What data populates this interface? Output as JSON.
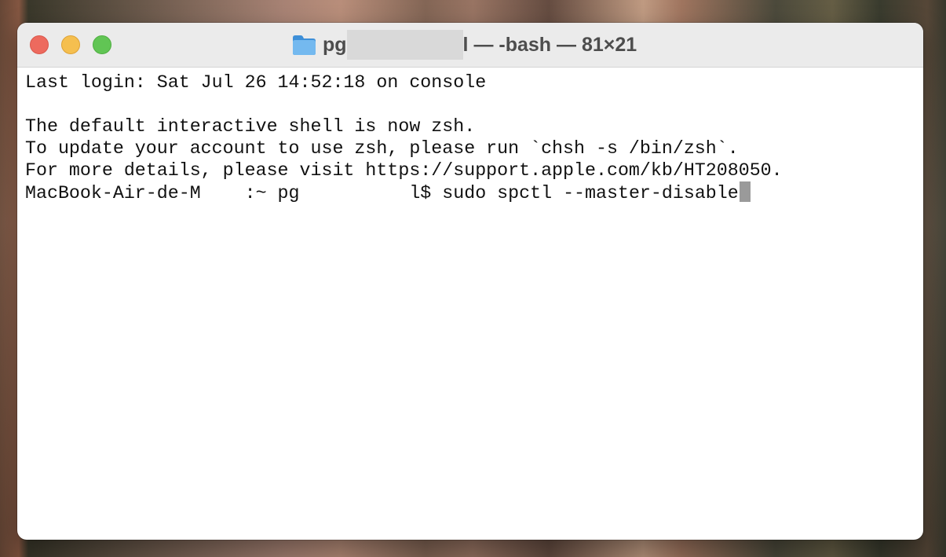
{
  "window": {
    "title_prefix": "pg",
    "title_suffix": "l — -bash — 81×21"
  },
  "terminal": {
    "lines": [
      "Last login: Sat Jul 26 14:52:18 on console",
      "",
      "The default interactive shell is now zsh.",
      "To update your account to use zsh, please run `chsh -s /bin/zsh`.",
      "For more details, please visit https://support.apple.com/kb/HT208050."
    ],
    "prompt": {
      "host": "MacBook-Air-de-M",
      "path_user": ":~ pg",
      "tail": "l$",
      "command": "sudo spctl --master-disable"
    }
  },
  "icons": {
    "folder": "folder-icon",
    "close": "close-window-button",
    "minimize": "minimize-window-button",
    "zoom": "zoom-window-button"
  },
  "colors": {
    "close": "#ed6a5e",
    "minimize": "#f5bf4f",
    "zoom": "#61c554",
    "folder": "#5aa9e6"
  }
}
